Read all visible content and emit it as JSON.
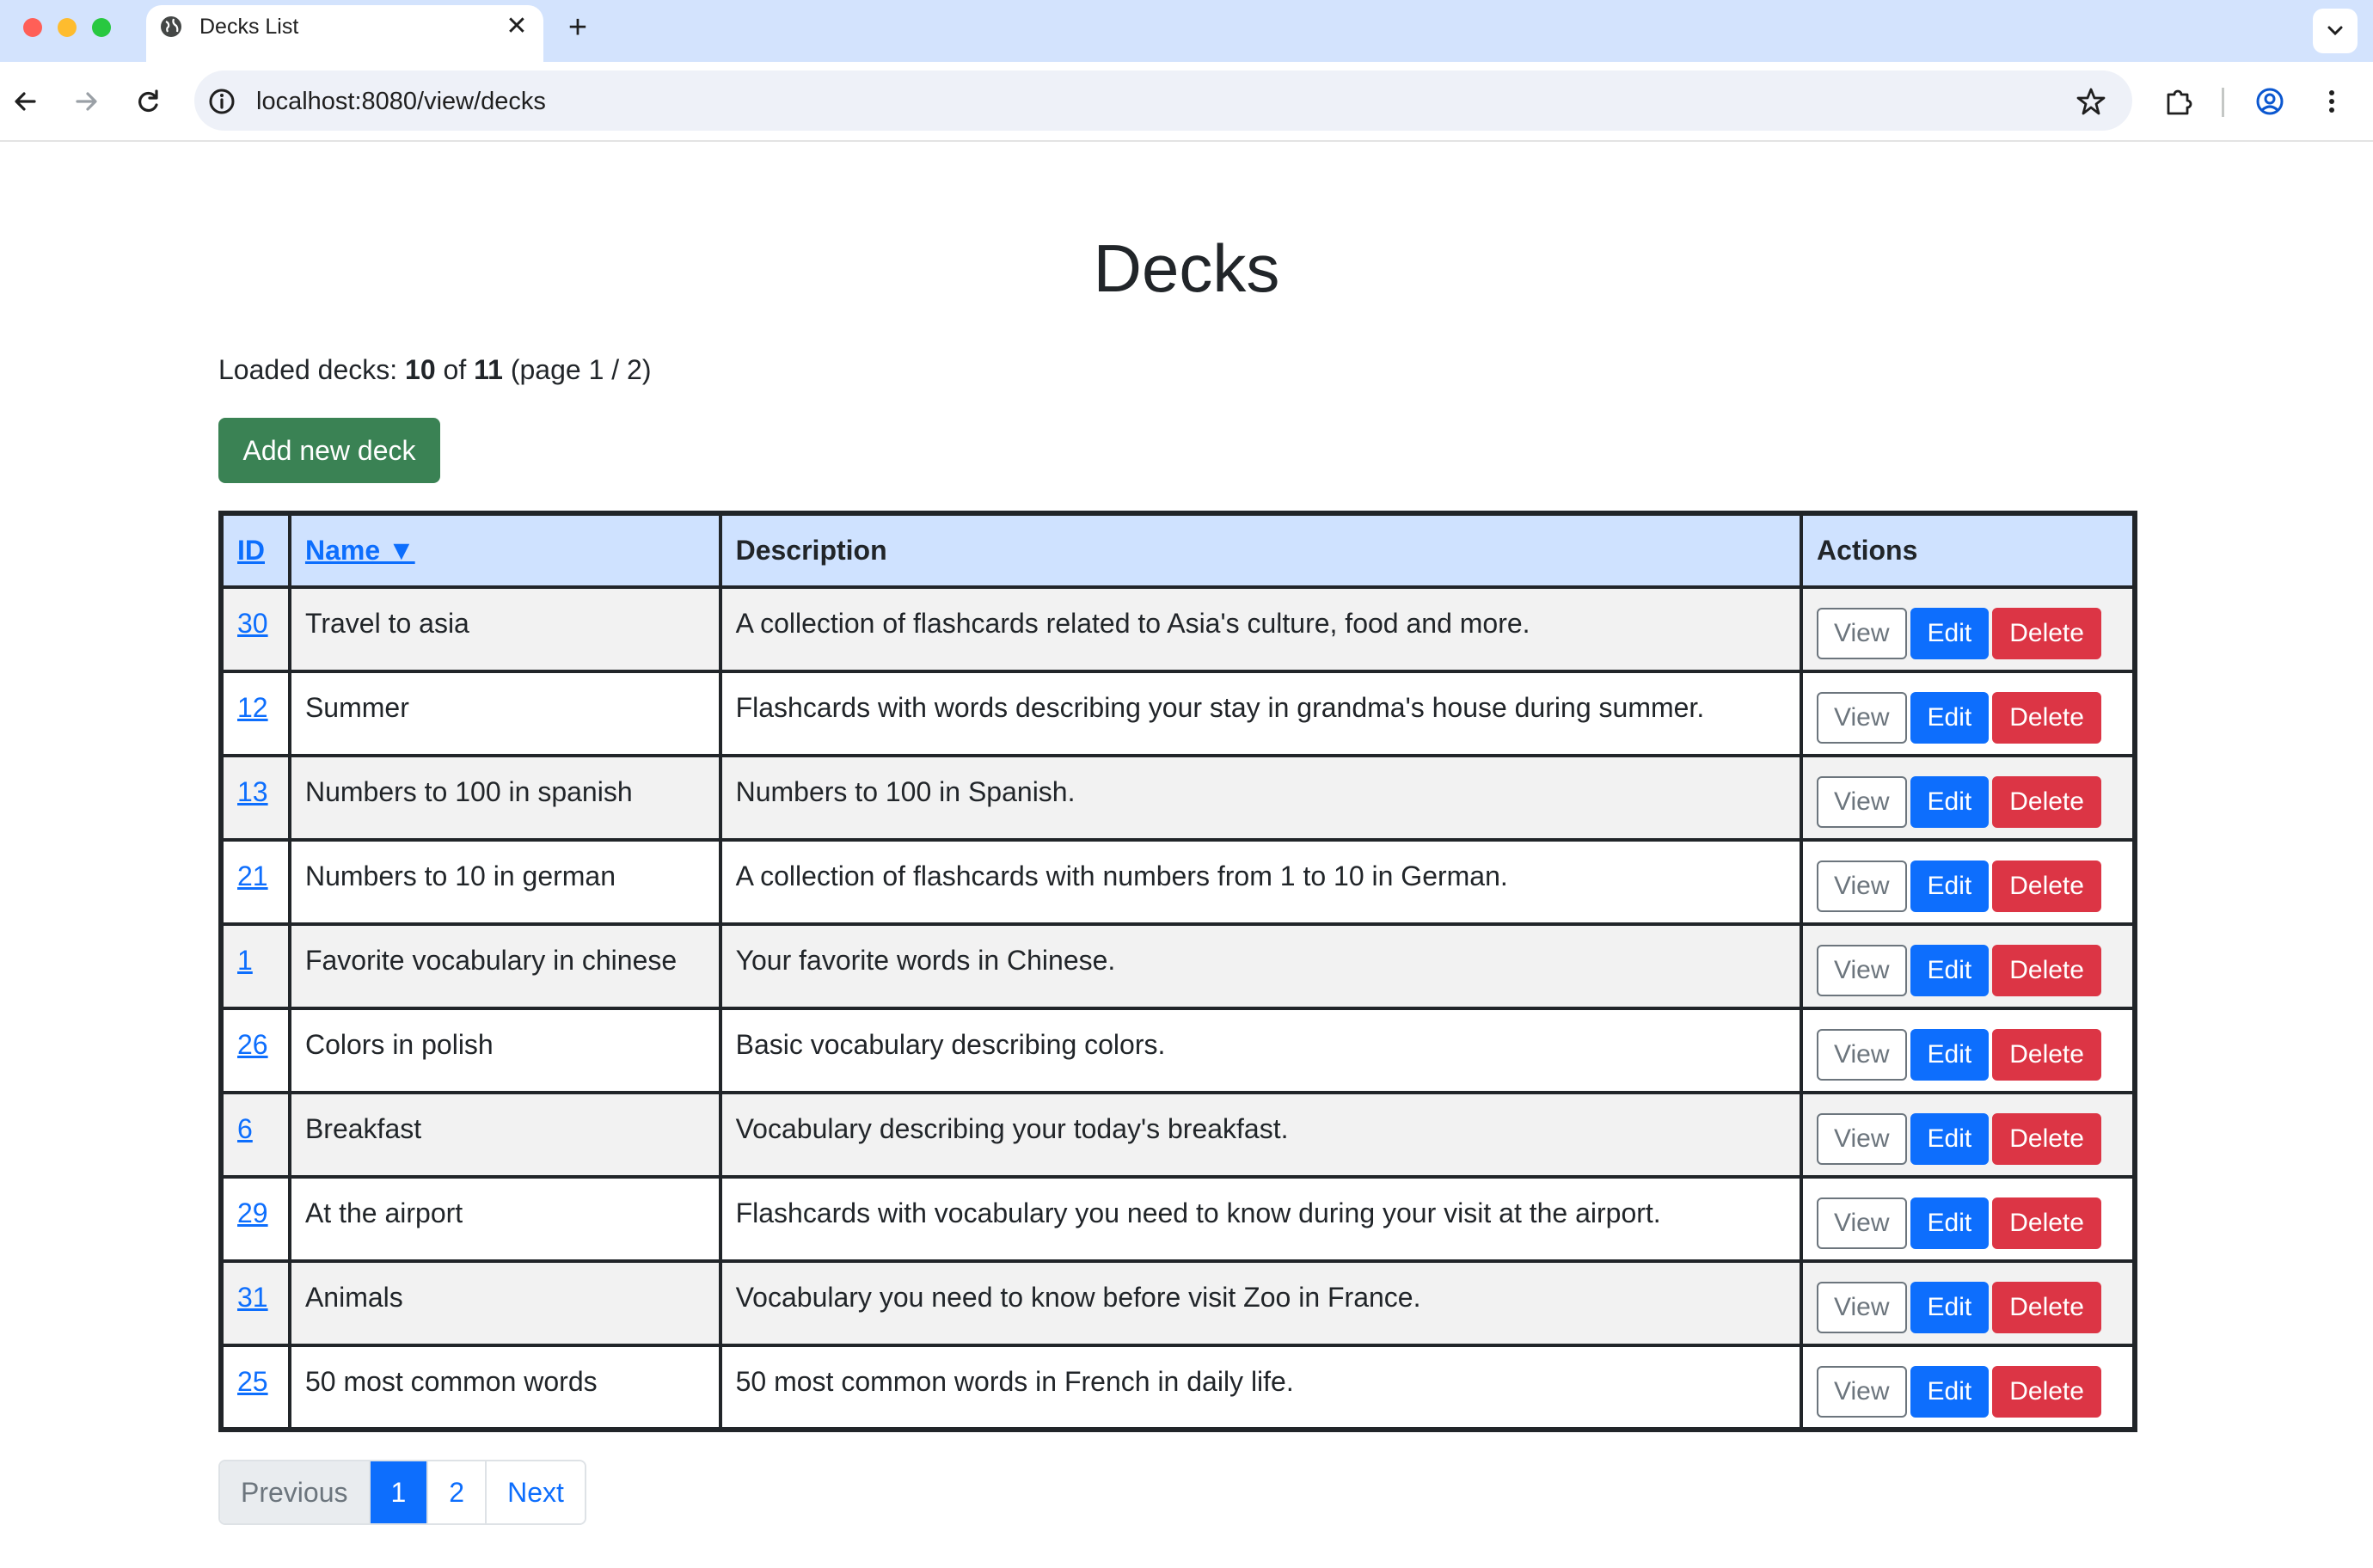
{
  "browser": {
    "tab_title": "Decks List",
    "url": "localhost:8080/view/decks",
    "new_tab_label": "+",
    "close_label": "✕"
  },
  "page": {
    "title": "Decks",
    "loaded_prefix": "Loaded decks: ",
    "loaded_count": "10",
    "loaded_of": " of ",
    "loaded_total": "11",
    "loaded_page": " (page 1 / 2)",
    "add_button": "Add new deck"
  },
  "table": {
    "headers": {
      "id": "ID",
      "name": "Name ▼",
      "description": "Description",
      "actions": "Actions"
    },
    "action_labels": {
      "view": "View",
      "edit": "Edit",
      "delete": "Delete"
    },
    "rows": [
      {
        "id": "30",
        "name": "Travel to asia",
        "description": "A collection of flashcards related to Asia's culture, food and more."
      },
      {
        "id": "12",
        "name": "Summer",
        "description": "Flashcards with words describing your stay in grandma's house during summer."
      },
      {
        "id": "13",
        "name": "Numbers to 100 in spanish",
        "description": "Numbers to 100 in Spanish."
      },
      {
        "id": "21",
        "name": "Numbers to 10 in german",
        "description": "A collection of flashcards with numbers from 1 to 10 in German."
      },
      {
        "id": "1",
        "name": "Favorite vocabulary in chinese",
        "description": "Your favorite words in Chinese."
      },
      {
        "id": "26",
        "name": "Colors in polish",
        "description": "Basic vocabulary describing colors."
      },
      {
        "id": "6",
        "name": "Breakfast",
        "description": "Vocabulary describing your today's breakfast."
      },
      {
        "id": "29",
        "name": "At the airport",
        "description": "Flashcards with vocabulary you need to know during your visit at the airport."
      },
      {
        "id": "31",
        "name": "Animals",
        "description": "Vocabulary you need to know before visit Zoo in France."
      },
      {
        "id": "25",
        "name": "50 most common words",
        "description": "50 most common words in French in daily life."
      }
    ]
  },
  "pagination": {
    "previous": "Previous",
    "pages": [
      "1",
      "2"
    ],
    "next": "Next"
  },
  "colors": {
    "header_bg": "#cfe2ff",
    "add_button": "#3a8254",
    "edit_button": "#0d6efd",
    "delete_button": "#dc3545",
    "link": "#0d6efd"
  }
}
